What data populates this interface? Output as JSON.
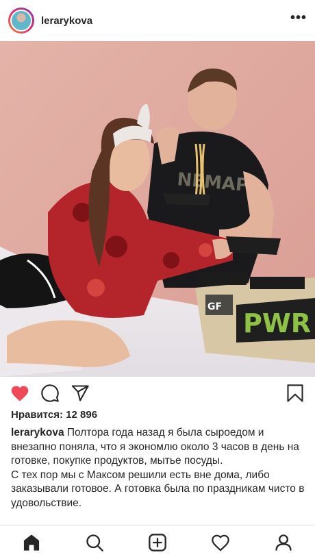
{
  "post": {
    "username": "lerarykova",
    "more_label": "•••",
    "likes_text": "Нравится: 12 896",
    "caption_username": "lerarykova",
    "caption_part1": "Полтора года назад я была сыроедом и внезапно поняла, что я экономлю около 3 часов в день на готовке, покупке продуктов, мытье посуды.",
    "caption_part2": "С тех пор мы с Максом решили есть вне дома, либо заказывали готовое. А готовка была по праздникам чисто в удовольствие.",
    "photo_box_logo": "GF",
    "photo_box_text": "PWR",
    "photo_shirt_text": "NEMAP"
  },
  "icons": {
    "like": "heart-filled-icon",
    "comment": "comment-icon",
    "share": "paper-plane-icon",
    "save": "bookmark-icon"
  },
  "tabs": [
    "home-icon",
    "search-icon",
    "add-post-icon",
    "activity-heart-icon",
    "profile-icon"
  ],
  "colors": {
    "like_red": "#ed4956",
    "text": "#262626",
    "divider": "#dbdbdb"
  }
}
